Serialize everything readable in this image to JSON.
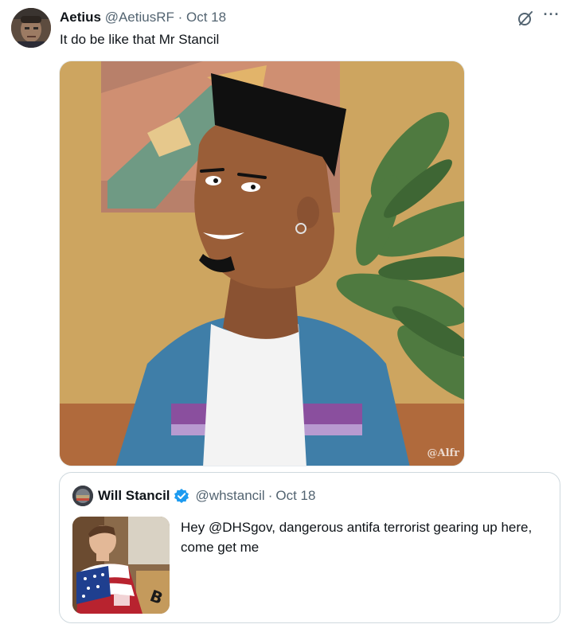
{
  "tweet": {
    "author_name": "Aetius",
    "author_handle": "@AetiusRF",
    "separator": "·",
    "date": "Oct 18",
    "text": "It do be like that Mr Stancil",
    "media": {
      "watermark": "@Alfr",
      "description_icon": "cartoon-character-image"
    }
  },
  "actions": {
    "grok_icon": "grok-icon",
    "more_icon": "more-options-icon",
    "more_glyph": "···"
  },
  "quoted_tweet": {
    "author_name": "Will Stancil",
    "verified": true,
    "author_handle": "@whstancil",
    "separator": "·",
    "date": "Oct 18",
    "text": "Hey @DHSgov, dangerous antifa terrorist gearing up here, come get me"
  },
  "colors": {
    "text_primary": "#0f1419",
    "text_secondary": "#536471",
    "verified_blue": "#1d9bf0",
    "border": "#cfd9de"
  }
}
